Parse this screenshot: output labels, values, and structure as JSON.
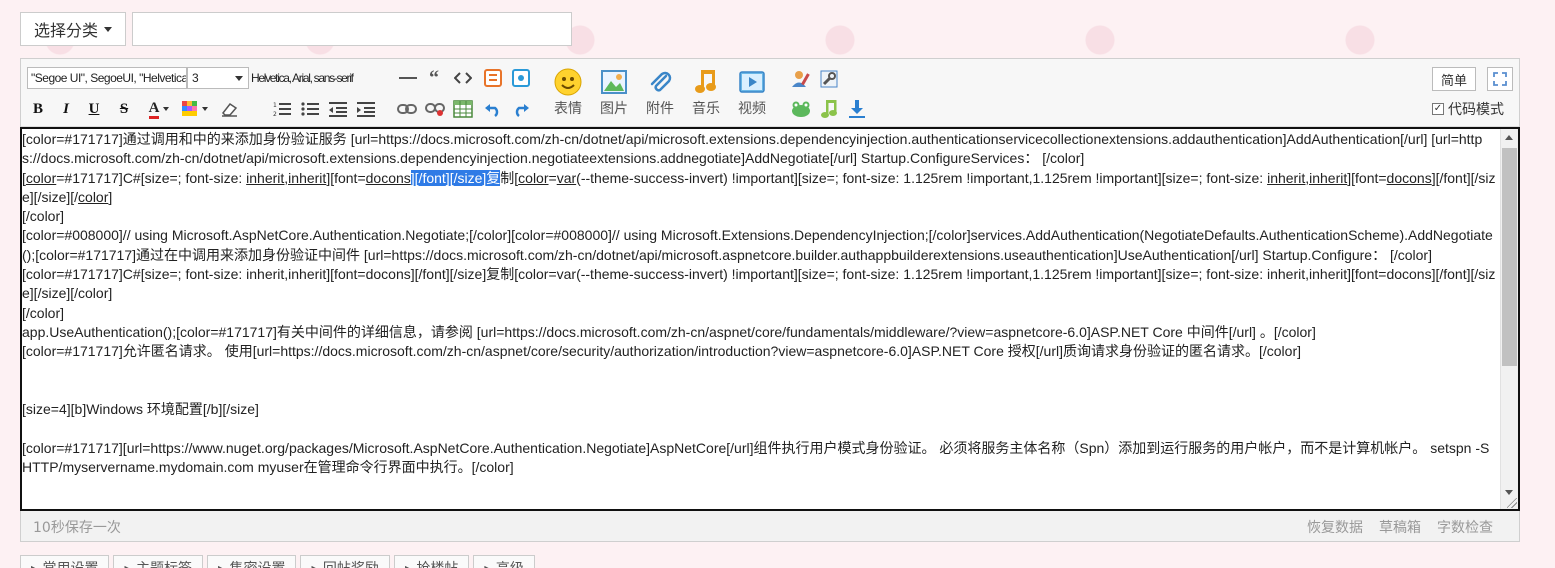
{
  "category": {
    "label": "选择分类"
  },
  "title_input": {
    "value": "",
    "placeholder": ""
  },
  "toolbar": {
    "font_family": "\"Segoe UI\", SegoeUI, \"Helvetica Neue\"",
    "font_size": "3",
    "font_preset": "Helvetica, Arial, sans-serif",
    "bold": "B",
    "italic": "I",
    "underline": "U",
    "strike": "S",
    "font_color": "A",
    "emoji_label": "表情",
    "image_label": "图片",
    "attach_label": "附件",
    "music_label": "音乐",
    "video_label": "视频",
    "mode_button": "简单",
    "code_mode_label": "代码模式",
    "code_mode_checked": true
  },
  "editor": {
    "segments": [
      {
        "text": "[color=#171717]通过调用和中的来添加身份验证服务 [url=https://docs.microsoft.com/zh-cn/dotnet/api/microsoft.extensions.dependencyinjection.authenticationservicecollectionextensions.addauthentication]AddAuthentication[/url] [url=https://docs.microsoft.com/zh-cn/dotnet/api/microsoft.extensions.dependencyinjection.negotiateextensions.addnegotiate]AddNegotiate[/url] Startup.ConfigureServices： [/color]\n["
      },
      {
        "text": "color",
        "style": "u"
      },
      {
        "text": "=#171717]C#[size=; font-size: "
      },
      {
        "text": "inherit,inherit",
        "style": "u"
      },
      {
        "text": "][font="
      },
      {
        "text": "docons",
        "style": "u"
      },
      {
        "text": "][/font][/size]复",
        "style": "sel"
      },
      {
        "text": "制["
      },
      {
        "text": "color",
        "style": "u"
      },
      {
        "text": "="
      },
      {
        "text": "var",
        "style": "u"
      },
      {
        "text": "(--theme-success-invert) !important][size=; font-size: 1.125rem !important,1.125rem !important][size=; font-size: "
      },
      {
        "text": "inherit,inherit",
        "style": "u"
      },
      {
        "text": "][font="
      },
      {
        "text": "docons",
        "style": "u"
      },
      {
        "text": "][/font][/size][/size][/"
      },
      {
        "text": "color",
        "style": "u"
      },
      {
        "text": "]\n[/color]\n[color=#008000]// using Microsoft.AspNetCore.Authentication.Negotiate;[/color][color=#008000]// using Microsoft.Extensions.DependencyInjection;[/color]services.AddAuthentication(NegotiateDefaults.AuthenticationScheme).AddNegotiate();[color=#171717]通过在中调用来添加身份验证中间件 [url=https://docs.microsoft.com/zh-cn/dotnet/api/microsoft.aspnetcore.builder.authappbuilderextensions.useauthentication]UseAuthentication[/url] Startup.Configure： [/color]\n[color=#171717]C#[size=; font-size: inherit,inherit][font=docons][/font][/size]复制[color=var(--theme-success-invert) !important][size=; font-size: 1.125rem !important,1.125rem !important][size=; font-size: inherit,inherit][font=docons][/font][/size][/size][/color]\n[/color]\napp.UseAuthentication();[color=#171717]有关中间件的详细信息，请参阅 [url=https://docs.microsoft.com/zh-cn/aspnet/core/fundamentals/middleware/?view=aspnetcore-6.0]ASP.NET Core 中间件[/url] 。[/color]\n[color=#171717]允许匿名请求。 使用[url=https://docs.microsoft.com/zh-cn/aspnet/core/security/authorization/introduction?view=aspnetcore-6.0]ASP.NET Core 授权[/url]质询请求身份验证的匿名请求。[/color]\n\n\n[size=4][b]Windows 环境配置[/b][/size]\n\n[color=#171717][url=https://www.nuget.org/packages/Microsoft.AspNetCore.Authentication.Negotiate]AspNetCore[/url]组件执行用户模式身份验证。 必须将服务主体名称（Spn）添加到运行服务的用户帐户，而不是计算机帐户。 setspn -S HTTP/myservername.mydomain.com myuser在管理命令行界面中执行。[/color]"
      }
    ]
  },
  "status": {
    "autosave": "10秒保存一次",
    "restore": "恢复数据",
    "drafts": "草稿箱",
    "wordcount": "字数检查"
  },
  "bottom_tabs": [
    "常用设置",
    "主题标签",
    "售密设置",
    "回帖奖励",
    "抢楼帖",
    "高级"
  ]
}
